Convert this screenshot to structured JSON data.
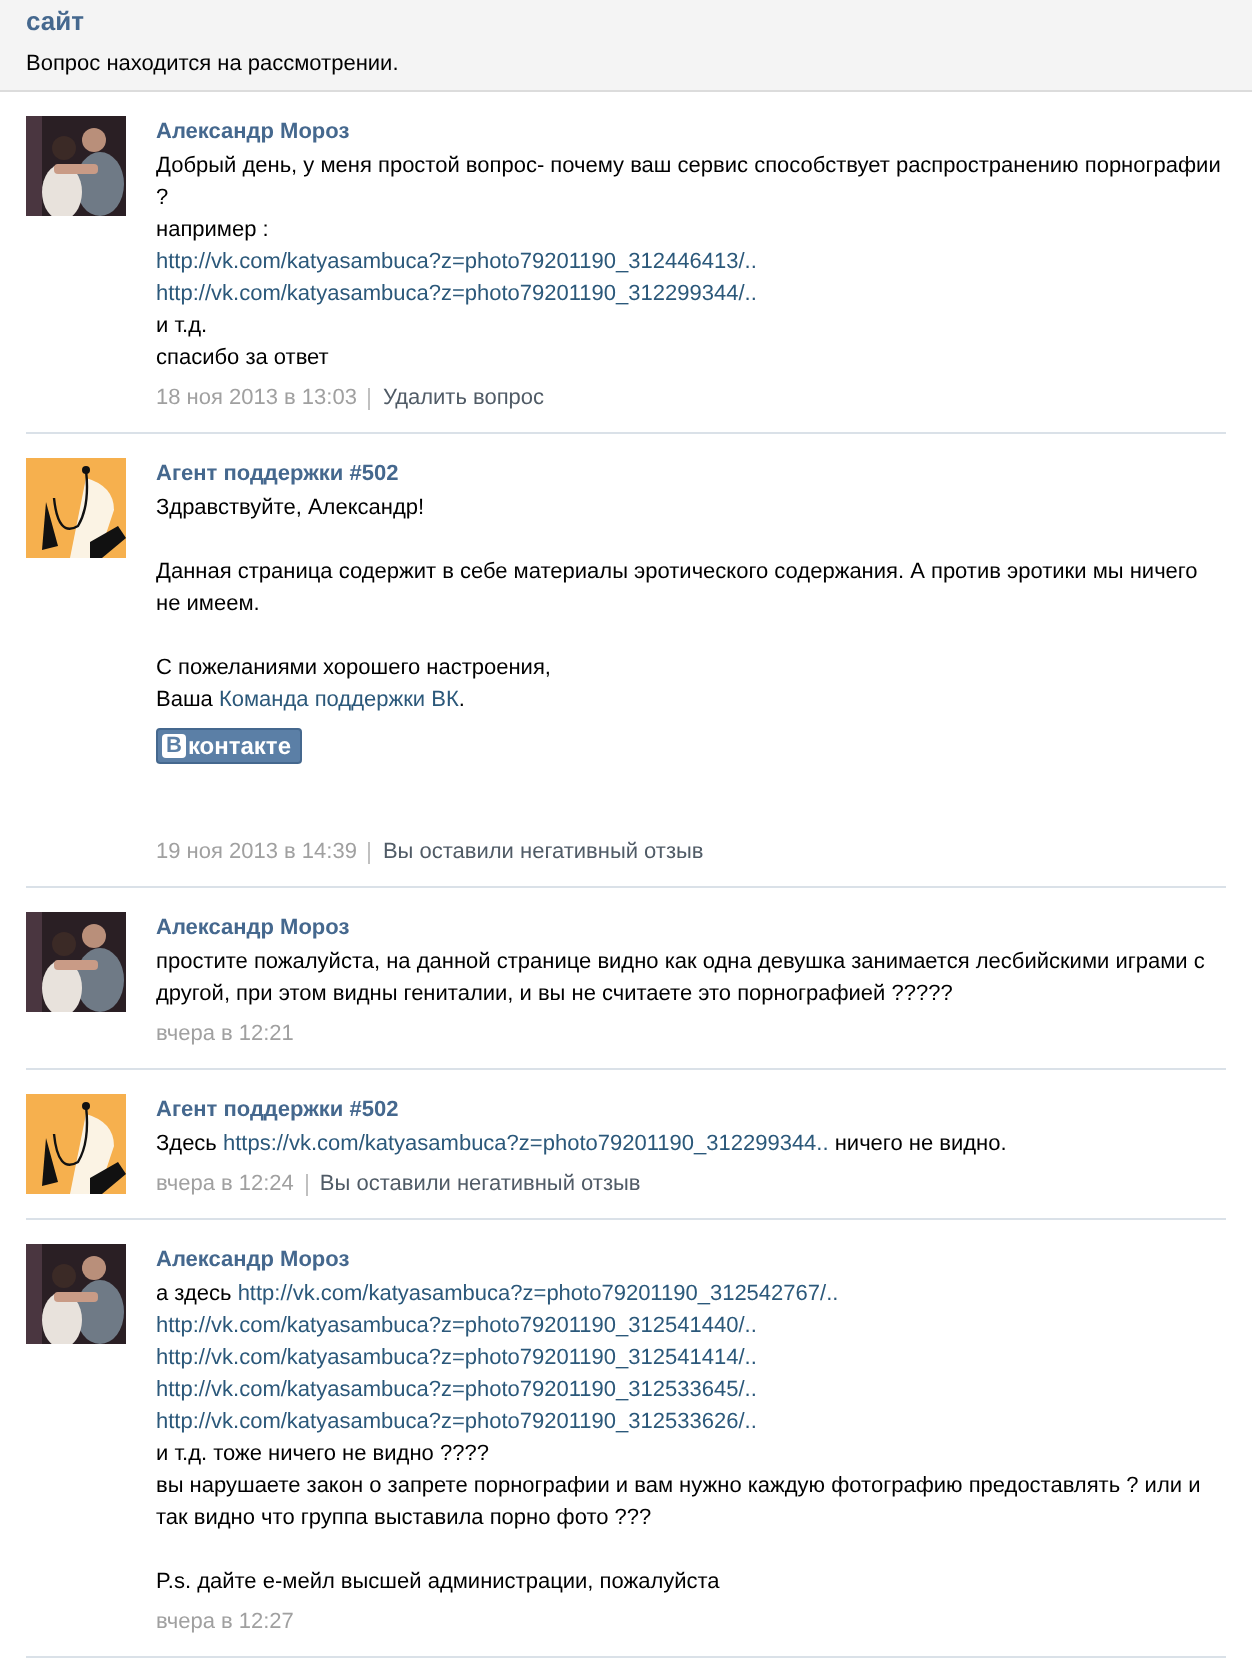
{
  "header": {
    "title": "сайт",
    "status": "Вопрос находится на рассмотрении."
  },
  "messages": [
    {
      "author": "Александр Мороз",
      "kind": "user",
      "paragraphs": [
        [
          [
            {
              "text": "Добрый день, у меня простой вопрос- почему ваш сервис способствует распространению порнографии",
              "link": false
            }
          ],
          [
            {
              "text": "?",
              "link": false
            }
          ],
          [
            {
              "text": "например :",
              "link": false
            }
          ],
          [
            {
              "text": "http://vk.com/katyasambuca?z=photo79201190_312446413/..",
              "link": true
            }
          ],
          [
            {
              "text": "http://vk.com/katyasambuca?z=photo79201190_312299344/..",
              "link": true
            }
          ],
          [
            {
              "text": "и т.д.",
              "link": false
            }
          ],
          [
            {
              "text": "спасибо за ответ",
              "link": false
            }
          ]
        ]
      ],
      "date": "18 ноя 2013 в 13:03",
      "action": "Удалить вопрос"
    },
    {
      "author": "Агент поддержки #502",
      "kind": "agent",
      "paragraphs": [
        [
          [
            {
              "text": "Здравствуйте, Александр!",
              "link": false
            }
          ]
        ],
        [
          [
            {
              "text": "Данная страница содержит в себе материалы эротического содержания. А против эротики мы ничего",
              "link": false
            }
          ],
          [
            {
              "text": "не имеем.",
              "link": false
            }
          ]
        ],
        [
          [
            {
              "text": "С пожеланиями хорошего настроения,",
              "link": false
            }
          ],
          [
            {
              "text": "Ваша ",
              "link": false
            },
            {
              "text": "Команда поддержки ВК",
              "link": true
            },
            {
              "text": ".",
              "link": false
            }
          ]
        ]
      ],
      "badge": {
        "letter": "В",
        "text": "контакте"
      },
      "date": "19 ноя 2013 в 14:39",
      "action": "Вы оставили негативный отзыв"
    },
    {
      "author": "Александр Мороз",
      "kind": "user",
      "paragraphs": [
        [
          [
            {
              "text": "простите пожалуйста, на данной странице видно как одна девушка занимается лесбийскими играми с",
              "link": false
            }
          ],
          [
            {
              "text": "другой, при этом видны гениталии, и вы не считаете это порнографией ?????",
              "link": false
            }
          ]
        ]
      ],
      "date": "вчера в 12:21"
    },
    {
      "author": "Агент поддержки #502",
      "kind": "agent",
      "paragraphs": [
        [
          [
            {
              "text": "Здесь ",
              "link": false
            },
            {
              "text": "https://vk.com/katyasambuca?z=photo79201190_312299344..",
              "link": true
            },
            {
              "text": " ничего не видно.",
              "link": false
            }
          ]
        ]
      ],
      "date": "вчера в 12:24",
      "action": "Вы оставили негативный отзыв"
    },
    {
      "author": "Александр Мороз",
      "kind": "user",
      "paragraphs": [
        [
          [
            {
              "text": "а здесь ",
              "link": false
            },
            {
              "text": "http://vk.com/katyasambuca?z=photo79201190_312542767/..",
              "link": true
            }
          ],
          [
            {
              "text": "http://vk.com/katyasambuca?z=photo79201190_312541440/..",
              "link": true
            }
          ],
          [
            {
              "text": "http://vk.com/katyasambuca?z=photo79201190_312541414/..",
              "link": true
            }
          ],
          [
            {
              "text": "http://vk.com/katyasambuca?z=photo79201190_312533645/..",
              "link": true
            }
          ],
          [
            {
              "text": "http://vk.com/katyasambuca?z=photo79201190_312533626/..",
              "link": true
            }
          ],
          [
            {
              "text": "и т.д. тоже ничего не видно ????",
              "link": false
            }
          ],
          [
            {
              "text": "вы нарушаете закон о запрете порнографии и вам нужно каждую фотографию предоставлять ? или и",
              "link": false
            }
          ],
          [
            {
              "text": "так видно что группа выставила порно фото ???",
              "link": false
            }
          ]
        ],
        [
          [
            {
              "text": "P.s. дайте е-мейл высшей администрации, пожалуйста",
              "link": false
            }
          ]
        ]
      ],
      "date": "вчера в 12:27"
    }
  ]
}
